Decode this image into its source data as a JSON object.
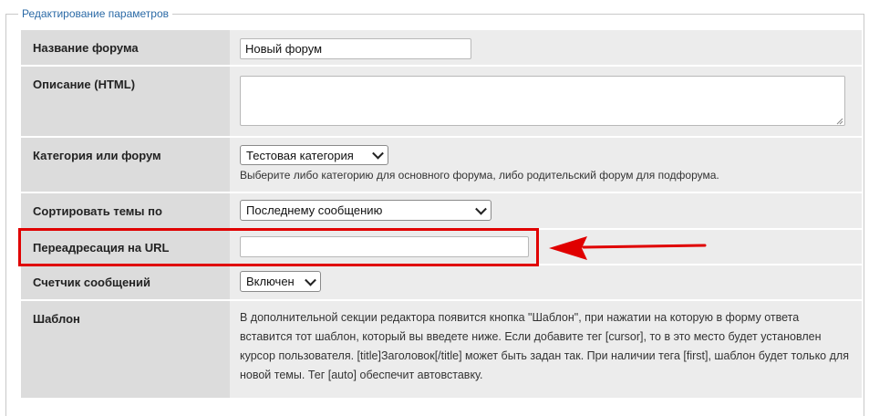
{
  "legend": "Редактирование параметров",
  "fields": {
    "forum_name": {
      "label": "Название форума",
      "value": "Новый форум"
    },
    "description": {
      "label": "Описание (HTML)",
      "value": ""
    },
    "category": {
      "label": "Категория или форум",
      "selected": "Тестовая категория",
      "hint": "Выберите либо категорию для основного форума, либо родительский форум для подфорума."
    },
    "sort_topics": {
      "label": "Сортировать темы по",
      "selected": "Последнему сообщению"
    },
    "redirect_url": {
      "label": "Переадресация на URL",
      "value": ""
    },
    "post_counter": {
      "label": "Счетчик сообщений",
      "selected": "Включен"
    },
    "template": {
      "label": "Шаблон",
      "description": "В дополнительной секции редактора появится кнопка \"Шаблон\", при нажатии на которую в форму ответа вставится тот шаблон, который вы введете ниже. Если добавите тег [cursor], то в это место будет установлен курсор пользователя. [title]Заголовок[/title] может быть задан так. При наличии тега [first], шаблон будет только для новой темы. Тег [auto] обеспечит автовставку."
    }
  },
  "annotation": {
    "highlight_color": "#e00000",
    "arrow_color": "#e00000"
  }
}
